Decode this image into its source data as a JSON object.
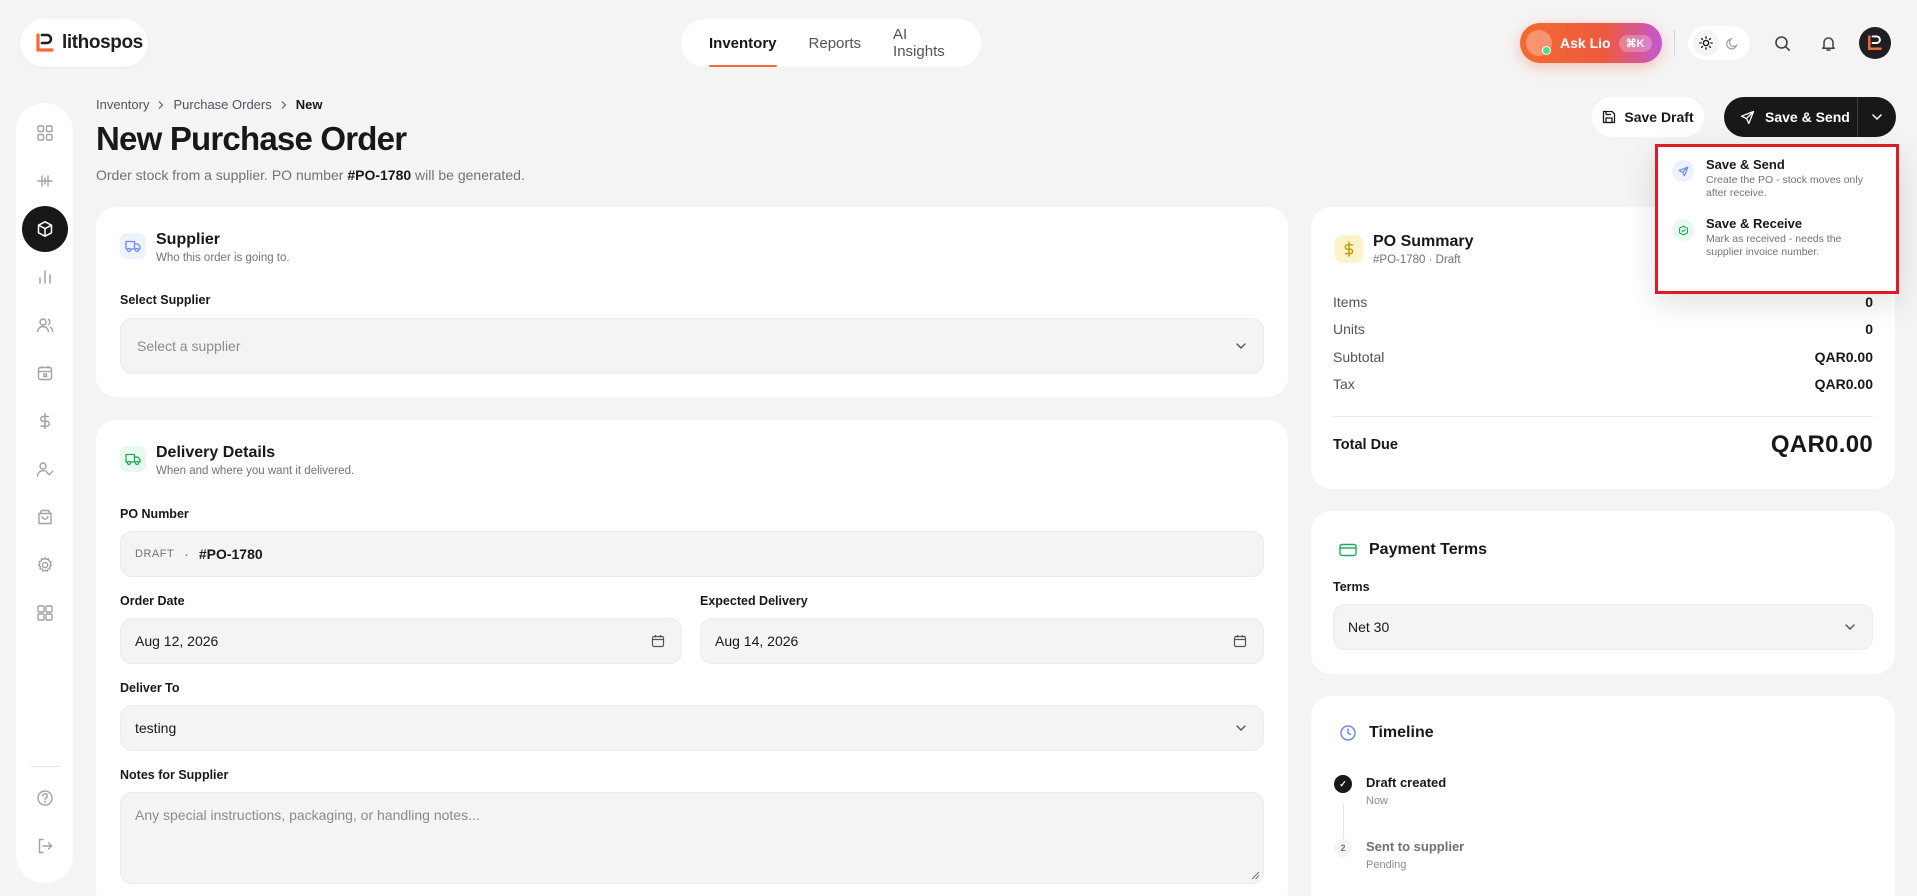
{
  "brand": {
    "name": "lithospos",
    "accent": "#f36a3a"
  },
  "topnav": {
    "tabs": [
      {
        "label": "Inventory",
        "active": true
      },
      {
        "label": "Reports",
        "active": false
      },
      {
        "label": "AI Insights",
        "active": false
      }
    ]
  },
  "header_actions": {
    "ask_label": "Ask Lio",
    "ask_shortcut": "⌘K"
  },
  "sidebar": {
    "items": [
      "dashboard-icon",
      "scan-icon",
      "box-icon",
      "chart-icon",
      "users-icon",
      "calendar-icon",
      "dollar-icon",
      "user-check-icon",
      "bag-icon",
      "settings-icon",
      "apps-icon"
    ],
    "active_index": 2,
    "bottom": [
      "help-icon",
      "logout-icon"
    ]
  },
  "breadcrumb": [
    "Inventory",
    "Purchase Orders",
    "New"
  ],
  "page": {
    "title": "New Purchase Order",
    "subtitle_pre": "Order stock from a supplier. PO number",
    "po_number": "#PO-1780",
    "subtitle_post": "will be generated."
  },
  "actions": {
    "save_draft": "Save Draft",
    "save_send": "Save & Send"
  },
  "dropdown": {
    "items": [
      {
        "title": "Save & Send",
        "desc": "Create the PO - stock moves only after receive."
      },
      {
        "title": "Save & Receive",
        "desc": "Mark as received - needs the supplier invoice number."
      }
    ]
  },
  "supplier": {
    "title": "Supplier",
    "subtitle": "Who this order is going to.",
    "select_label": "Select Supplier",
    "select_placeholder": "Select a supplier"
  },
  "delivery": {
    "title": "Delivery Details",
    "subtitle": "When and where you want it delivered.",
    "po_label": "PO Number",
    "po_status": "DRAFT",
    "po_sep": "·",
    "po_value": "#PO-1780",
    "order_date_label": "Order Date",
    "order_date": "Aug 12, 2026",
    "expected_label": "Expected Delivery",
    "expected_date": "Aug 14, 2026",
    "deliver_to_label": "Deliver To",
    "deliver_to": "testing",
    "notes_label": "Notes for Supplier",
    "notes_placeholder": "Any special instructions, packaging, or handling notes..."
  },
  "summary": {
    "title": "PO Summary",
    "subtitle": "#PO-1780 · Draft",
    "rows": [
      {
        "label": "Items",
        "value": "0"
      },
      {
        "label": "Units",
        "value": "0"
      },
      {
        "label": "Subtotal",
        "value": "QAR0.00"
      },
      {
        "label": "Tax",
        "value": "QAR0.00"
      }
    ],
    "total_label": "Total Due",
    "total_value": "QAR0.00"
  },
  "payment": {
    "title": "Payment Terms",
    "terms_label": "Terms",
    "terms_value": "Net 30"
  },
  "timeline": {
    "title": "Timeline",
    "steps": [
      {
        "marker": "✓",
        "label": "Draft created",
        "sub": "Now",
        "done": true
      },
      {
        "marker": "2",
        "label": "Sent to supplier",
        "sub": "Pending",
        "done": false
      }
    ]
  }
}
